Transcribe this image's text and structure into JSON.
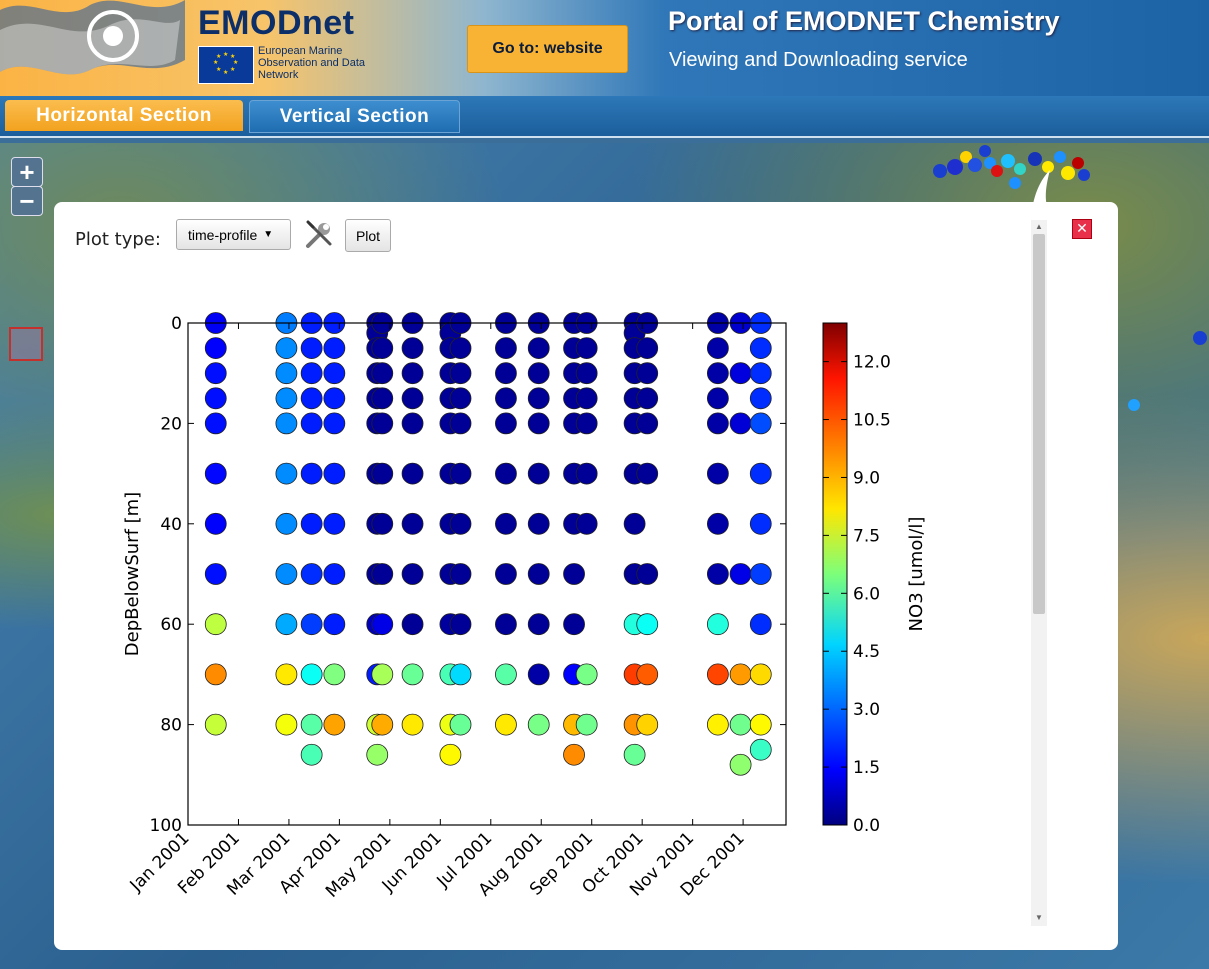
{
  "header": {
    "brand": "EMODnet",
    "brand_sub": "European Marine Observation and Data Network",
    "goto_label": "Go to: website",
    "portal_title": "Portal of EMODNET Chemistry",
    "portal_sub": "Viewing and Downloading service"
  },
  "tabs": [
    {
      "label": "Horizontal Section",
      "active": true
    },
    {
      "label": "Vertical Section",
      "active": false
    }
  ],
  "map": {
    "zoom_in": "+",
    "zoom_out": "−"
  },
  "panel": {
    "plot_type_label": "Plot type:",
    "plot_type_value": "time-profile",
    "plot_button": "Plot",
    "close_icon": "close-icon",
    "wrench_icon": "wrench-icon"
  },
  "colors": {
    "accent": "#f7a823",
    "header_blue": "#1c63a6",
    "close_red": "#e8304a"
  },
  "chart_data": {
    "type": "scatter",
    "ylabel": "DepBelowSurf [m]",
    "colorbar_label": "NO3 [umol/l]",
    "ylim": [
      100,
      0
    ],
    "yticks": [
      0,
      20,
      40,
      60,
      80,
      100
    ],
    "xlim": [
      0,
      12
    ],
    "xtick_labels": [
      "Jan 2001",
      "Feb 2001",
      "Mar 2001",
      "Apr 2001",
      "May 2001",
      "Jun 2001",
      "Jul 2001",
      "Aug 2001",
      "Sep 2001",
      "Oct 2001",
      "Nov 2001",
      "Dec 2001"
    ],
    "clim": [
      0,
      13
    ],
    "colorbar_ticks": [
      "0.0",
      "1.5",
      "3.0",
      "4.5",
      "6.0",
      "7.5",
      "9.0",
      "10.5",
      "12.0"
    ],
    "profiles": [
      {
        "month": 0.55,
        "points": [
          [
            0,
            1.5
          ],
          [
            5,
            1.6
          ],
          [
            10,
            1.8
          ],
          [
            15,
            1.8
          ],
          [
            20,
            1.8
          ],
          [
            30,
            1.7
          ],
          [
            40,
            1.6
          ],
          [
            50,
            1.8
          ],
          [
            60,
            7.3
          ],
          [
            70,
            9.6
          ],
          [
            80,
            7.4
          ]
        ]
      },
      {
        "month": 1.95,
        "points": [
          [
            0,
            3.2
          ],
          [
            5,
            3.4
          ],
          [
            10,
            3.4
          ],
          [
            15,
            3.4
          ],
          [
            20,
            3.4
          ],
          [
            30,
            3.4
          ],
          [
            40,
            3.4
          ],
          [
            50,
            3.4
          ],
          [
            60,
            3.8
          ],
          [
            70,
            8.4
          ],
          [
            80,
            8.0
          ]
        ]
      },
      {
        "month": 2.45,
        "points": [
          [
            0,
            2.0
          ],
          [
            5,
            2.0
          ],
          [
            10,
            2.0
          ],
          [
            15,
            2.0
          ],
          [
            20,
            2.0
          ],
          [
            30,
            2.0
          ],
          [
            40,
            2.0
          ],
          [
            50,
            2.2
          ],
          [
            60,
            2.4
          ],
          [
            70,
            5.0
          ],
          [
            80,
            6.0
          ],
          [
            86,
            5.8
          ]
        ]
      },
      {
        "month": 2.9,
        "points": [
          [
            0,
            2.0
          ],
          [
            5,
            2.0
          ],
          [
            10,
            2.0
          ],
          [
            15,
            2.0
          ],
          [
            20,
            2.0
          ],
          [
            30,
            2.0
          ],
          [
            40,
            2.0
          ],
          [
            50,
            2.0
          ],
          [
            60,
            2.0
          ],
          [
            70,
            6.5
          ],
          [
            80,
            9.3
          ]
        ]
      },
      {
        "month": 3.75,
        "points": [
          [
            0,
            0.3
          ],
          [
            2,
            0.3
          ],
          [
            5,
            0.3
          ],
          [
            10,
            0.3
          ],
          [
            15,
            0.3
          ],
          [
            20,
            0.3
          ],
          [
            30,
            0.3
          ],
          [
            40,
            0.3
          ],
          [
            50,
            0.3
          ],
          [
            60,
            0.8
          ],
          [
            70,
            2.0
          ],
          [
            80,
            7.5
          ],
          [
            86,
            6.8
          ]
        ]
      },
      {
        "month": 3.85,
        "points": [
          [
            0,
            0.3
          ],
          [
            5,
            0.3
          ],
          [
            10,
            0.3
          ],
          [
            15,
            0.3
          ],
          [
            20,
            0.3
          ],
          [
            30,
            0.3
          ],
          [
            40,
            0.3
          ],
          [
            50,
            0.3
          ],
          [
            60,
            1.3
          ],
          [
            70,
            7.0
          ],
          [
            80,
            9.2
          ]
        ]
      },
      {
        "month": 4.45,
        "points": [
          [
            0,
            0.3
          ],
          [
            5,
            0.3
          ],
          [
            10,
            0.3
          ],
          [
            15,
            0.3
          ],
          [
            20,
            0.3
          ],
          [
            30,
            0.3
          ],
          [
            40,
            0.3
          ],
          [
            50,
            0.3
          ],
          [
            60,
            0.3
          ],
          [
            70,
            6.2
          ],
          [
            80,
            8.4
          ]
        ]
      },
      {
        "month": 5.2,
        "points": [
          [
            0,
            0.3
          ],
          [
            2,
            0.3
          ],
          [
            5,
            0.3
          ],
          [
            10,
            0.3
          ],
          [
            15,
            0.3
          ],
          [
            20,
            0.3
          ],
          [
            30,
            0.3
          ],
          [
            40,
            0.3
          ],
          [
            50,
            0.3
          ],
          [
            60,
            0.4
          ],
          [
            70,
            5.8
          ],
          [
            80,
            7.9
          ],
          [
            86,
            8.2
          ]
        ]
      },
      {
        "month": 5.4,
        "points": [
          [
            0,
            0.3
          ],
          [
            5,
            0.3
          ],
          [
            10,
            0.3
          ],
          [
            15,
            0.3
          ],
          [
            20,
            0.3
          ],
          [
            30,
            0.3
          ],
          [
            40,
            0.3
          ],
          [
            50,
            0.3
          ],
          [
            60,
            0.3
          ],
          [
            70,
            4.4
          ],
          [
            80,
            6.2
          ]
        ]
      },
      {
        "month": 6.3,
        "points": [
          [
            0,
            0.3
          ],
          [
            5,
            0.3
          ],
          [
            10,
            0.3
          ],
          [
            15,
            0.3
          ],
          [
            20,
            0.3
          ],
          [
            30,
            0.3
          ],
          [
            40,
            0.3
          ],
          [
            50,
            0.3
          ],
          [
            60,
            0.3
          ],
          [
            70,
            6.0
          ],
          [
            80,
            8.4
          ]
        ]
      },
      {
        "month": 6.95,
        "points": [
          [
            0,
            0.3
          ],
          [
            5,
            0.3
          ],
          [
            10,
            0.3
          ],
          [
            15,
            0.3
          ],
          [
            20,
            0.3
          ],
          [
            30,
            0.3
          ],
          [
            40,
            0.3
          ],
          [
            50,
            0.3
          ],
          [
            60,
            0.3
          ],
          [
            70,
            0.5
          ],
          [
            80,
            6.4
          ]
        ]
      },
      {
        "month": 7.65,
        "points": [
          [
            0,
            0.3
          ],
          [
            5,
            0.3
          ],
          [
            10,
            0.3
          ],
          [
            15,
            0.3
          ],
          [
            20,
            0.3
          ],
          [
            30,
            0.3
          ],
          [
            40,
            0.3
          ],
          [
            50,
            0.3
          ],
          [
            60,
            0.3
          ],
          [
            70,
            1.6
          ],
          [
            80,
            9.0
          ],
          [
            86,
            9.6
          ]
        ]
      },
      {
        "month": 7.9,
        "points": [
          [
            0,
            0.3
          ],
          [
            5,
            0.3
          ],
          [
            10,
            0.3
          ],
          [
            15,
            0.3
          ],
          [
            20,
            0.3
          ],
          [
            30,
            0.3
          ],
          [
            40,
            0.3
          ],
          [
            70,
            6.4
          ],
          [
            80,
            6.3
          ]
        ]
      },
      {
        "month": 8.85,
        "points": [
          [
            0,
            0.3
          ],
          [
            2,
            0.3
          ],
          [
            5,
            0.3
          ],
          [
            10,
            0.3
          ],
          [
            15,
            0.3
          ],
          [
            20,
            0.3
          ],
          [
            30,
            0.3
          ],
          [
            40,
            0.3
          ],
          [
            50,
            0.3
          ],
          [
            60,
            5.3
          ],
          [
            70,
            10.6
          ],
          [
            80,
            9.5
          ],
          [
            86,
            6.2
          ]
        ]
      },
      {
        "month": 9.1,
        "points": [
          [
            0,
            0.3
          ],
          [
            5,
            0.3
          ],
          [
            10,
            0.3
          ],
          [
            15,
            0.3
          ],
          [
            20,
            0.3
          ],
          [
            30,
            0.3
          ],
          [
            50,
            0.3
          ],
          [
            60,
            5.0
          ],
          [
            70,
            10.2
          ],
          [
            80,
            8.7
          ]
        ]
      },
      {
        "month": 10.5,
        "points": [
          [
            0,
            0.5
          ],
          [
            5,
            0.5
          ],
          [
            10,
            0.5
          ],
          [
            15,
            0.5
          ],
          [
            20,
            0.5
          ],
          [
            30,
            0.5
          ],
          [
            40,
            0.5
          ],
          [
            50,
            0.5
          ],
          [
            60,
            5.3
          ],
          [
            70,
            10.5
          ],
          [
            80,
            8.3
          ]
        ]
      },
      {
        "month": 10.95,
        "points": [
          [
            0,
            1.0
          ],
          [
            10,
            1.2
          ],
          [
            20,
            1.1
          ],
          [
            50,
            1.3
          ],
          [
            70,
            9.4
          ],
          [
            80,
            6.3
          ],
          [
            88,
            6.7
          ]
        ]
      },
      {
        "month": 11.35,
        "points": [
          [
            0,
            2.2
          ],
          [
            5,
            2.2
          ],
          [
            10,
            2.2
          ],
          [
            15,
            2.2
          ],
          [
            20,
            2.6
          ],
          [
            30,
            2.2
          ],
          [
            40,
            2.2
          ],
          [
            50,
            2.4
          ],
          [
            60,
            2.2
          ],
          [
            70,
            8.6
          ],
          [
            80,
            8.2
          ],
          [
            85,
            5.6
          ]
        ]
      }
    ]
  }
}
